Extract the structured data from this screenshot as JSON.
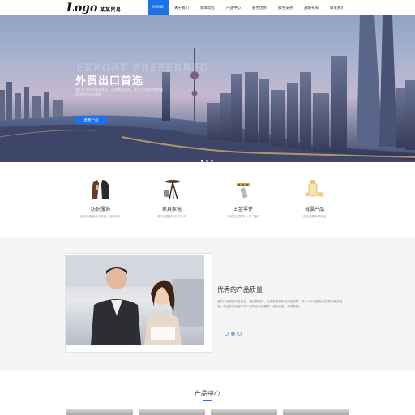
{
  "header": {
    "logo_word": "Logo",
    "logo_tag": "某某贸易",
    "nav": [
      "HOME",
      "关于我们",
      "新闻动态",
      "产品中心",
      "服务优势",
      "服务支持",
      "战略布局",
      "联系我们"
    ]
  },
  "hero": {
    "ghost_text": "EXPORT PREFERRED",
    "title": "外贸出口首选",
    "subtitle": "我们专注外贸服务多年，业务覆盖全球，致力于为客户提供最优质的产品与服务",
    "button": "查看产品"
  },
  "categories": [
    {
      "title": "纺织服饰",
      "desc": "面料及服装出口配套，优质设计",
      "icon": "clothing-icon"
    },
    {
      "title": "家具家电",
      "desc": "现代家居家电外贸出口",
      "icon": "lamp-icon"
    },
    {
      "title": "五金零件",
      "desc": "精品五金配件，出厂直销",
      "icon": "hardware-icon"
    },
    {
      "title": "母婴产品",
      "desc": "安全健康母婴用品",
      "icon": "baby-bottle-icon"
    }
  ],
  "feature": {
    "title": "优秀的产品质量",
    "text": "我们以优质的产品质量、最优的服务，为外贸商提供坚实的保障。每一个产品都经过层层严格的检验，保证交付给客户的产品符合标准要求，诚信经营，共同发展。"
  },
  "products": {
    "title": "产品中心"
  },
  "colors": {
    "accent": "#1a73e8"
  }
}
